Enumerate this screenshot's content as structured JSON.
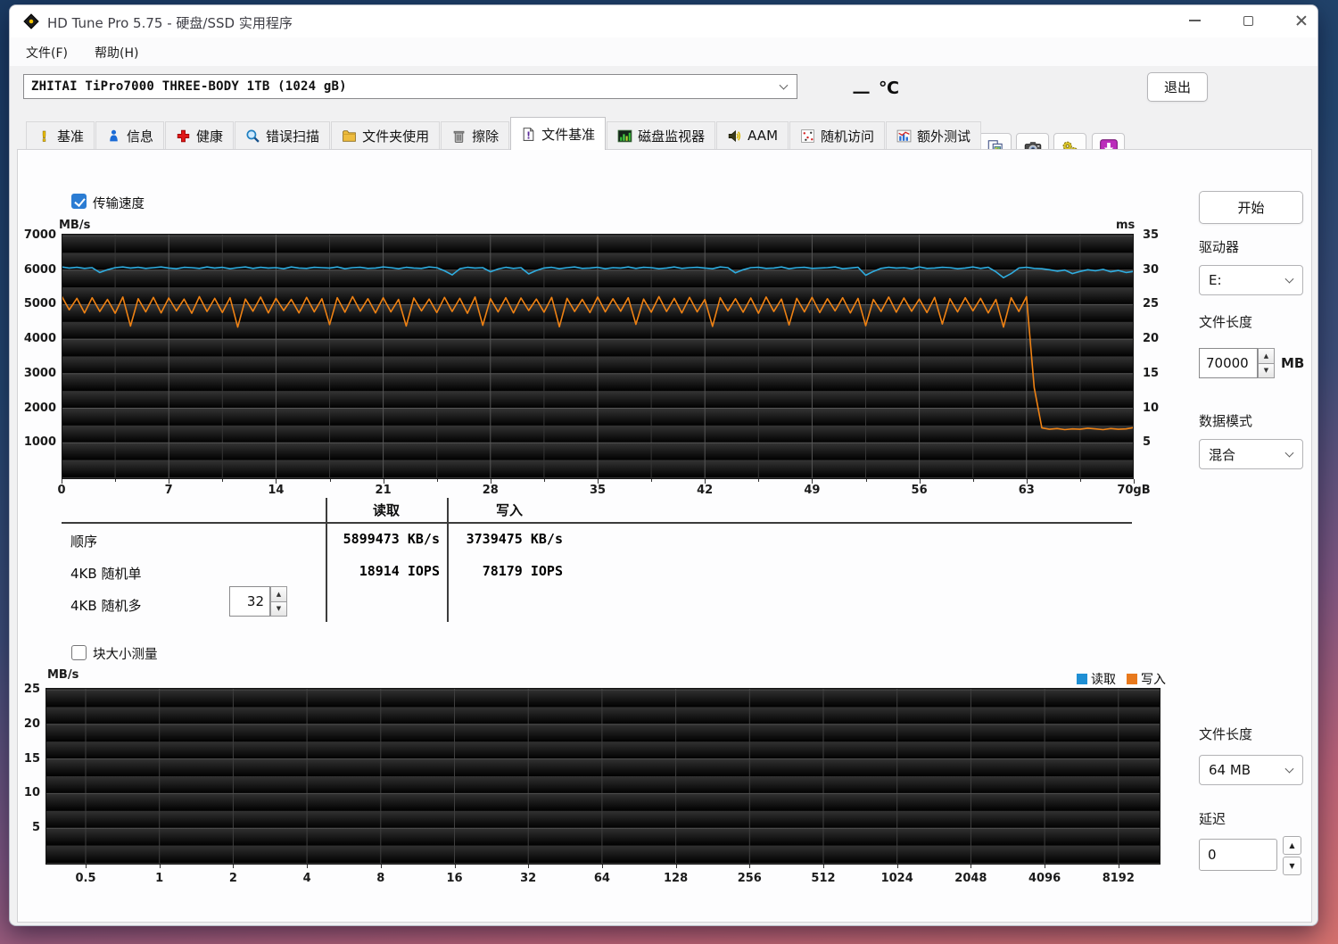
{
  "window": {
    "title": "HD Tune Pro 5.75 - 硬盘/SSD 实用程序"
  },
  "menu": {
    "file": "文件(F)",
    "help": "帮助(H)"
  },
  "toolbar": {
    "drive_select": "ZHITAI TiPro7000 THREE-BODY 1TB (1024 gB)",
    "temperature_value": "一",
    "temperature_unit": "℃",
    "exit_button": "退出",
    "buttons": [
      {
        "name": "temperature-button",
        "icon": "thermometer"
      },
      {
        "name": "copy-text-button",
        "icon": "copy-text"
      },
      {
        "name": "copy-image-button",
        "icon": "copy-image"
      },
      {
        "name": "screenshot-button",
        "icon": "screenshot"
      },
      {
        "name": "options-button",
        "icon": "options"
      },
      {
        "name": "save-button",
        "icon": "save"
      }
    ]
  },
  "tabs": {
    "selected": "文件基准",
    "items": [
      {
        "label": "基准",
        "icon": "bench"
      },
      {
        "label": "信息",
        "icon": "info"
      },
      {
        "label": "健康",
        "icon": "health"
      },
      {
        "label": "错误扫描",
        "icon": "scan"
      },
      {
        "label": "文件夹使用",
        "icon": "folder"
      },
      {
        "label": "擦除",
        "icon": "erase"
      },
      {
        "label": "文件基准",
        "icon": "filebench"
      },
      {
        "label": "磁盘监视器",
        "icon": "monitor"
      },
      {
        "label": "AAM",
        "icon": "aam"
      },
      {
        "label": "随机访问",
        "icon": "random"
      },
      {
        "label": "额外测试",
        "icon": "extra"
      }
    ]
  },
  "file_benchmark": {
    "transfer_checkbox": {
      "label": "传输速度",
      "checked": true
    },
    "block_checkbox": {
      "label": "块大小测量",
      "checked": false
    },
    "stats": {
      "col_read": "读取",
      "col_write": "写入",
      "queue_depth": "32",
      "rows": [
        {
          "label": "顺序",
          "read": "5899473 KB/s",
          "write": "3739475 KB/s"
        },
        {
          "label": "4KB 随机单",
          "read": "18914 IOPS",
          "write": "78179 IOPS"
        },
        {
          "label": "4KB 随机多",
          "read": "",
          "write": ""
        }
      ]
    },
    "legend": {
      "read": "读取",
      "write": "写入",
      "read_color": "#1f8fd4",
      "write_color": "#e8791c"
    }
  },
  "sidebar": {
    "start_button": "开始",
    "drive_label": "驱动器",
    "drive_value": "E:",
    "file_length_label": "文件长度",
    "file_length_value": "70000",
    "file_length_unit": "MB",
    "data_mode_label": "数据模式",
    "data_mode_value": "混合",
    "file_length2_label": "文件长度",
    "file_length2_value": "64 MB",
    "delay_label": "延迟",
    "delay_value": "0"
  },
  "chart_data": [
    {
      "id": "transfer-speed",
      "type": "line",
      "title": "传输速度",
      "x_range": [
        0,
        70
      ],
      "x_ticks": [
        0,
        7,
        14,
        21,
        28,
        35,
        42,
        49,
        56,
        63
      ],
      "x_last_label": "70gB",
      "y_left_label": "MB/s",
      "y_left_ticks": [
        7000,
        6000,
        5000,
        4000,
        3000,
        2000,
        1000
      ],
      "y_right_label": "ms",
      "y_right_ticks": [
        35,
        30,
        25,
        20,
        15,
        10,
        5
      ],
      "grid": true,
      "series": [
        {
          "name": "读取",
          "color": "#2fadе0",
          "color_hex": "#2fade0",
          "x_start": 0,
          "x_step": 0.5,
          "values": [
            6090,
            6060,
            6080,
            6050,
            6070,
            5930,
            6010,
            6070,
            6090,
            6060,
            6080,
            6050,
            6070,
            6090,
            6060,
            6040,
            6080,
            6070,
            6050,
            6090,
            6060,
            6080,
            6040,
            6070,
            6090,
            6050,
            6080,
            6060,
            6070,
            6040,
            6090,
            6060,
            6050,
            6080,
            6070,
            6060,
            6090,
            6040,
            6070,
            6080,
            6050,
            6060,
            6090,
            6070,
            6040,
            6080,
            6060,
            6050,
            6090,
            6070,
            5980,
            5860,
            6040,
            6080,
            6060,
            6070,
            5950,
            6030,
            6080,
            6050,
            6070,
            5890,
            5990,
            6060,
            6080,
            6040,
            6070,
            6090,
            6050,
            6060,
            6080,
            6040,
            6070,
            6060,
            6090,
            6050,
            6080,
            6070,
            6040,
            6060,
            6090,
            6050,
            6070,
            6080,
            6060,
            6040,
            6090,
            6070,
            5920,
            6010,
            6070,
            6080,
            6050,
            6060,
            6090,
            6040,
            6070,
            6080,
            6050,
            6060,
            6070,
            6090,
            6040,
            6060,
            6080,
            5850,
            5960,
            6050,
            6080,
            6060,
            6070,
            6040,
            6090,
            6050,
            6060,
            6080,
            6070,
            6040,
            6060,
            6090,
            6050,
            6080,
            5950,
            5780,
            5900,
            6060,
            6080,
            6050,
            6040,
            6010,
            5970,
            6000,
            5900,
            5960,
            6010,
            5980,
            6020,
            5950,
            5990,
            5930,
            5960
          ]
        },
        {
          "name": "写入",
          "color_hex": "#ef8214",
          "x_start": 0,
          "x_step": 0.5,
          "values": [
            5250,
            4850,
            5180,
            4760,
            5200,
            4800,
            5150,
            4750,
            5220,
            4380,
            5170,
            4790,
            5210,
            4760,
            5190,
            4820,
            5160,
            4750,
            5230,
            4800,
            5180,
            4770,
            5200,
            4350,
            5160,
            4810,
            5220,
            4760,
            5180,
            4830,
            5150,
            4760,
            5210,
            4790,
            5170,
            4420,
            5200,
            4780,
            5230,
            4810,
            5170,
            4760,
            5200,
            4790,
            5150,
            4380,
            5190,
            4820,
            5160,
            4770,
            5210,
            4800,
            5180,
            4750,
            5220,
            4400,
            5170,
            4790,
            5200,
            4760,
            5190,
            4830,
            5160,
            4780,
            5210,
            4360,
            5180,
            4800,
            5150,
            4770,
            5220,
            4790,
            5170,
            4810,
            5200,
            4430,
            5160,
            4780,
            5230,
            4800,
            5180,
            4760,
            5210,
            4790,
            5150,
            4370,
            5200,
            4820,
            5170,
            4780,
            5190,
            4750,
            5220,
            4800,
            5160,
            4410,
            5180,
            4790,
            5210,
            4770,
            5170,
            4820,
            5200,
            4760,
            5180,
            4390,
            5150,
            4800,
            5220,
            4780,
            5190,
            4810,
            5160,
            4770,
            5210,
            4440,
            5170,
            4790,
            5200,
            4820,
            5180,
            4760,
            5150,
            4350,
            5200,
            4800,
            5230,
            2600,
            1430,
            1390,
            1410,
            1380,
            1400,
            1390,
            1420,
            1400,
            1380,
            1410,
            1390,
            1400,
            1440
          ]
        }
      ]
    },
    {
      "id": "block-size",
      "type": "line",
      "title": "块大小测量",
      "y_label": "MB/s",
      "y_ticks": [
        25,
        20,
        15,
        10,
        5
      ],
      "x_tick_labels": [
        "0.5",
        "1",
        "2",
        "4",
        "8",
        "16",
        "32",
        "64",
        "128",
        "256",
        "512",
        "1024",
        "2048",
        "4096",
        "8192"
      ],
      "grid": true,
      "series": []
    }
  ]
}
